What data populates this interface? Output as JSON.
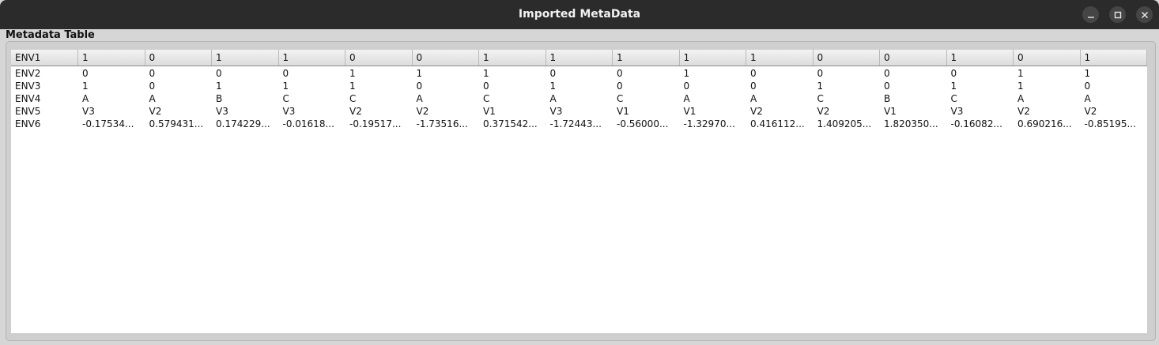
{
  "window": {
    "title": "Imported MetaData"
  },
  "panel": {
    "label": "Metadata Table"
  },
  "table": {
    "header": [
      "ENV1",
      "1",
      "0",
      "1",
      "1",
      "0",
      "0",
      "1",
      "1",
      "1",
      "1",
      "1",
      "0",
      "0",
      "1",
      "0",
      "1"
    ],
    "rows": [
      [
        "ENV2",
        "0",
        "0",
        "0",
        "0",
        "1",
        "1",
        "1",
        "0",
        "0",
        "1",
        "0",
        "0",
        "0",
        "0",
        "1",
        "1"
      ],
      [
        "ENV3",
        "1",
        "0",
        "1",
        "1",
        "1",
        "0",
        "0",
        "1",
        "0",
        "0",
        "0",
        "1",
        "0",
        "1",
        "1",
        "0"
      ],
      [
        "ENV4",
        "A",
        "A",
        "B",
        "C",
        "C",
        "A",
        "C",
        "A",
        "C",
        "A",
        "A",
        "C",
        "B",
        "C",
        "A",
        "A"
      ],
      [
        "ENV5",
        "V3",
        "V2",
        "V3",
        "V3",
        "V2",
        "V2",
        "V1",
        "V3",
        "V1",
        "V1",
        "V2",
        "V2",
        "V1",
        "V3",
        "V2",
        "V2"
      ],
      [
        "ENV6",
        "-0.17534...",
        "0.579431...",
        "0.174229...",
        "-0.01618...",
        "-0.19517...",
        "-1.73516...",
        "0.371542...",
        "-1.72443...",
        "-0.56000...",
        "-1.32970...",
        "0.416112...",
        "1.409205...",
        "1.820350...",
        "-0.16082...",
        "0.690216...",
        "-0.85195..."
      ]
    ]
  }
}
